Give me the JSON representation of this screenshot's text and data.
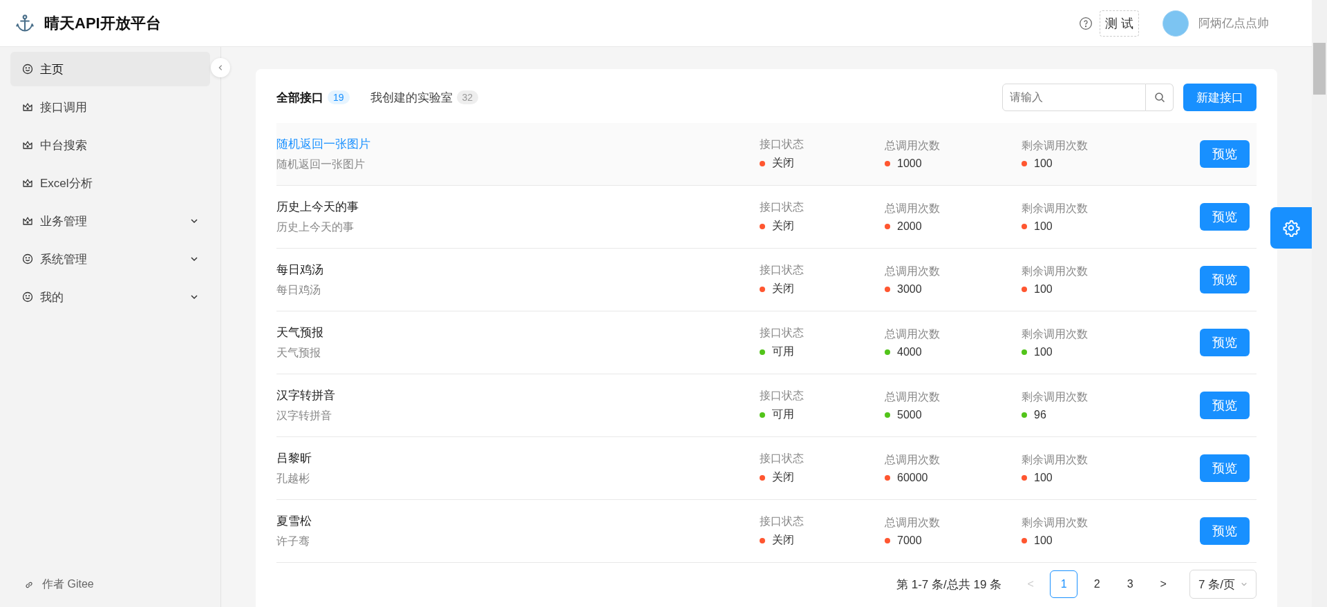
{
  "header": {
    "title": "晴天API开放平台",
    "test_button": "测 试",
    "user_name": "阿炳亿点点帅"
  },
  "sidebar": {
    "items": [
      {
        "label": "主页",
        "kind": "smile",
        "selected": true,
        "expandable": false
      },
      {
        "label": "接口调用",
        "kind": "crown",
        "selected": false,
        "expandable": false
      },
      {
        "label": "中台搜索",
        "kind": "crown",
        "selected": false,
        "expandable": false
      },
      {
        "label": "Excel分析",
        "kind": "crown",
        "selected": false,
        "expandable": false
      },
      {
        "label": "业务管理",
        "kind": "crown",
        "selected": false,
        "expandable": true
      },
      {
        "label": "系统管理",
        "kind": "smile",
        "selected": false,
        "expandable": true
      },
      {
        "label": "我的",
        "kind": "smile",
        "selected": false,
        "expandable": true
      }
    ],
    "footer_link": "作者 Gitee"
  },
  "tabs": [
    {
      "label": "全部接口",
      "count": "19",
      "selected": true
    },
    {
      "label": "我创建的实验室",
      "count": "32",
      "selected": false
    }
  ],
  "search": {
    "placeholder": "请输入"
  },
  "new_button": "新建接口",
  "rows": [
    {
      "title": "随机返回一张图片",
      "description": "随机返回一张图片",
      "selected": true,
      "stats": [
        {
          "label": "接口状态",
          "value": "关闭",
          "color": "#ff5630"
        },
        {
          "label": "总调用次数",
          "value": "1000",
          "color": "#ff5630"
        },
        {
          "label": "剩余调用次数",
          "value": "100",
          "color": "#ff5630"
        }
      ],
      "button": "预览"
    },
    {
      "title": "历史上今天的事",
      "description": "历史上今天的事",
      "selected": false,
      "stats": [
        {
          "label": "接口状态",
          "value": "关闭",
          "color": "#ff5630"
        },
        {
          "label": "总调用次数",
          "value": "2000",
          "color": "#ff5630"
        },
        {
          "label": "剩余调用次数",
          "value": "100",
          "color": "#ff5630"
        }
      ],
      "button": "预览"
    },
    {
      "title": "每日鸡汤",
      "description": "每日鸡汤",
      "selected": false,
      "stats": [
        {
          "label": "接口状态",
          "value": "关闭",
          "color": "#ff5630"
        },
        {
          "label": "总调用次数",
          "value": "3000",
          "color": "#ff5630"
        },
        {
          "label": "剩余调用次数",
          "value": "100",
          "color": "#ff5630"
        }
      ],
      "button": "预览"
    },
    {
      "title": "天气预报",
      "description": "天气预报",
      "selected": false,
      "stats": [
        {
          "label": "接口状态",
          "value": "可用",
          "color": "#52c41a"
        },
        {
          "label": "总调用次数",
          "value": "4000",
          "color": "#52c41a"
        },
        {
          "label": "剩余调用次数",
          "value": "100",
          "color": "#52c41a"
        }
      ],
      "button": "预览"
    },
    {
      "title": "汉字转拼音",
      "description": "汉字转拼音",
      "selected": false,
      "stats": [
        {
          "label": "接口状态",
          "value": "可用",
          "color": "#52c41a"
        },
        {
          "label": "总调用次数",
          "value": "5000",
          "color": "#52c41a"
        },
        {
          "label": "剩余调用次数",
          "value": "96",
          "color": "#52c41a"
        }
      ],
      "button": "预览"
    },
    {
      "title": "吕黎昕",
      "description": "孔越彬",
      "selected": false,
      "stats": [
        {
          "label": "接口状态",
          "value": "关闭",
          "color": "#ff5630"
        },
        {
          "label": "总调用次数",
          "value": "60000",
          "color": "#ff5630"
        },
        {
          "label": "剩余调用次数",
          "value": "100",
          "color": "#ff5630"
        }
      ],
      "button": "预览"
    },
    {
      "title": "夏雪松",
      "description": "许子骞",
      "selected": false,
      "stats": [
        {
          "label": "接口状态",
          "value": "关闭",
          "color": "#ff5630"
        },
        {
          "label": "总调用次数",
          "value": "7000",
          "color": "#ff5630"
        },
        {
          "label": "剩余调用次数",
          "value": "100",
          "color": "#ff5630"
        }
      ],
      "button": "预览"
    }
  ],
  "pagination": {
    "summary": "第 1-7 条/总共 19 条",
    "prev": "<",
    "next": ">",
    "pages": [
      {
        "label": "1",
        "selected": true
      },
      {
        "label": "2",
        "selected": false
      },
      {
        "label": "3",
        "selected": false
      }
    ],
    "page_size": "7 条/页"
  }
}
